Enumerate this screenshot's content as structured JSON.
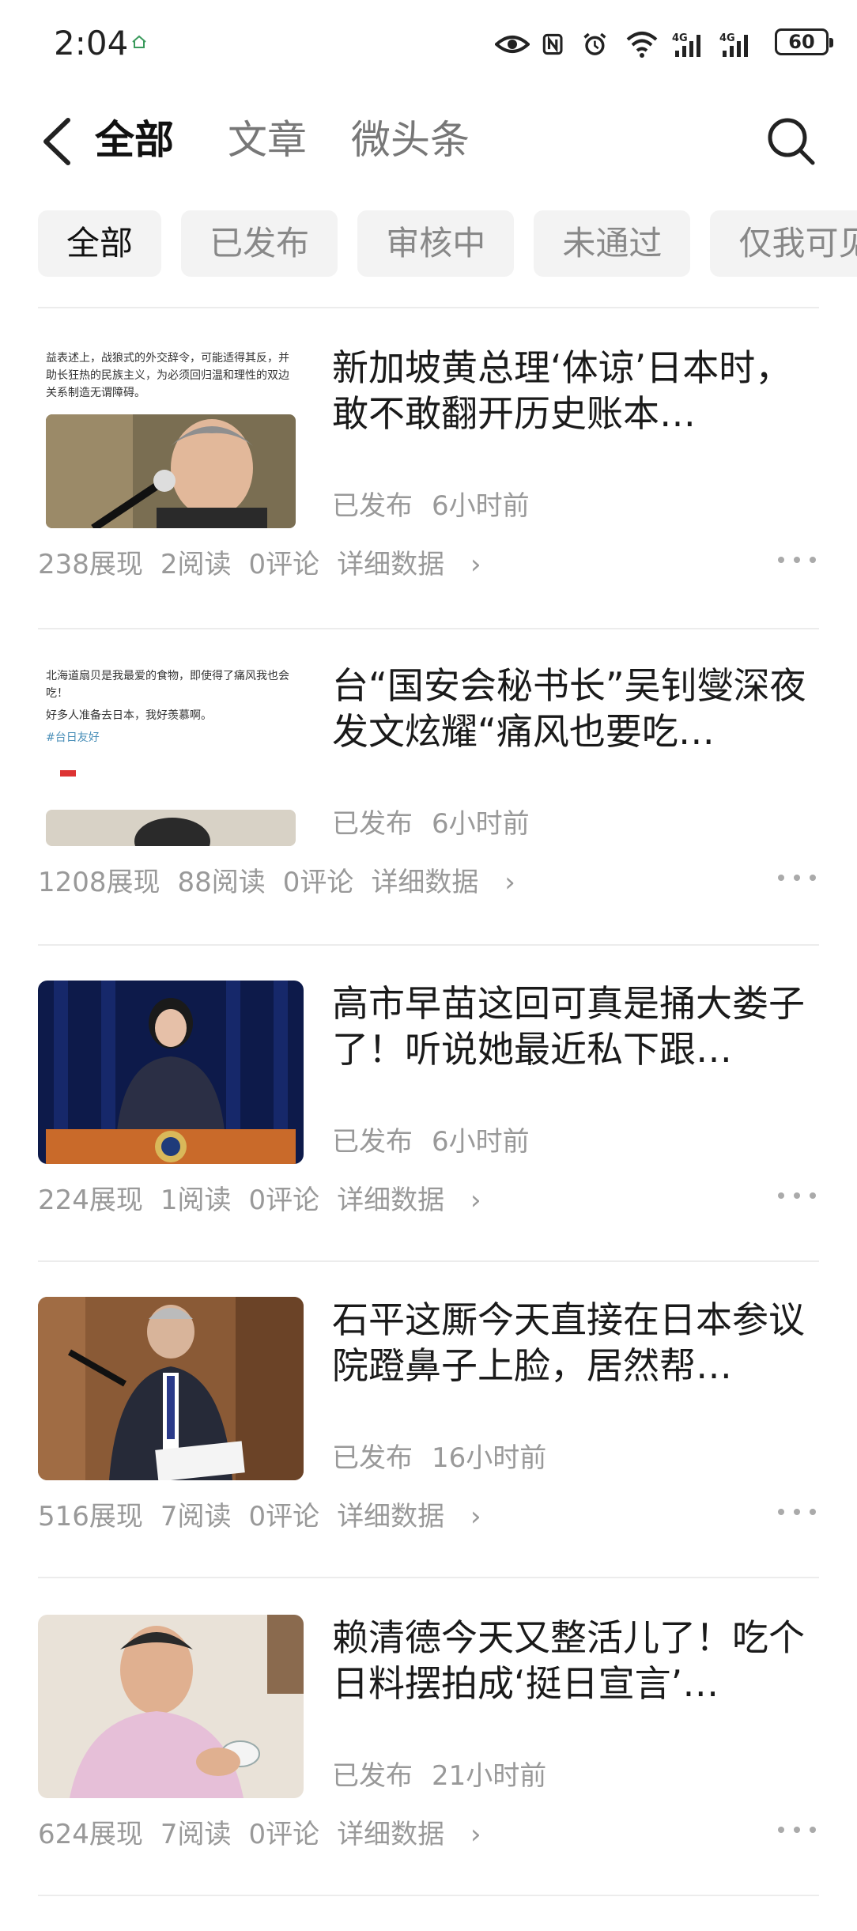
{
  "status_bar": {
    "time": "2:04",
    "battery": "60",
    "icons": [
      "home-icon",
      "eye-icon",
      "nfc-icon",
      "alarm-icon",
      "wifi-icon",
      "signal-4g-icon",
      "signal-4g-icon",
      "battery-icon"
    ]
  },
  "header": {
    "tabs": [
      {
        "label": "全部",
        "active": true
      },
      {
        "label": "文章",
        "active": false
      },
      {
        "label": "微头条",
        "active": false
      }
    ]
  },
  "filters": [
    {
      "label": "全部",
      "active": true
    },
    {
      "label": "已发布",
      "active": false
    },
    {
      "label": "审核中",
      "active": false
    },
    {
      "label": "未通过",
      "active": false
    },
    {
      "label": "仅我可见",
      "active": false
    }
  ],
  "articles": [
    {
      "title": "新加坡黄总理‘体谅’日本时，敢不敢翻开历史账本…",
      "thumb_text": "益表述上，战狼式的外交辞令，可能适得其反，并助长狂热的民族主义，为必须回归温和理性的双边关系制造无谓障碍。",
      "status": "已发布",
      "time": "6小时前",
      "views": "238展现",
      "reads": "2阅读",
      "comments": "0评论",
      "detail": "详细数据"
    },
    {
      "title": "台“国安会秘书长”吴钊燮深夜发文炫耀“痛风也要吃…",
      "thumb_text": "北海道扇贝是我最爱的食物，即使得了痛风我也会吃！",
      "thumb_text2": "好多人准备去日本，我好羡慕啊。",
      "thumb_tag": "#台日友好",
      "status": "已发布",
      "time": "6小时前",
      "views": "1208展现",
      "reads": "88阅读",
      "comments": "0评论",
      "detail": "详细数据"
    },
    {
      "title": "高市早苗这回可真是捅大娄子了！听说她最近私下跟…",
      "status": "已发布",
      "time": "6小时前",
      "views": "224展现",
      "reads": "1阅读",
      "comments": "0评论",
      "detail": "详细数据"
    },
    {
      "title": "石平这厮今天直接在日本参议院蹬鼻子上脸，居然帮…",
      "status": "已发布",
      "time": "16小时前",
      "views": "516展现",
      "reads": "7阅读",
      "comments": "0评论",
      "detail": "详细数据"
    },
    {
      "title": "赖清德今天又整活儿了！吃个日料摆拍成‘挺日宣言’…",
      "status": "已发布",
      "time": "21小时前",
      "views": "624展现",
      "reads": "7阅读",
      "comments": "0评论",
      "detail": "详细数据"
    }
  ],
  "colors": {
    "text_primary": "#1a1a1a",
    "text_secondary": "#999999",
    "chip_bg": "#f3f3f3",
    "divider": "#ececec"
  }
}
